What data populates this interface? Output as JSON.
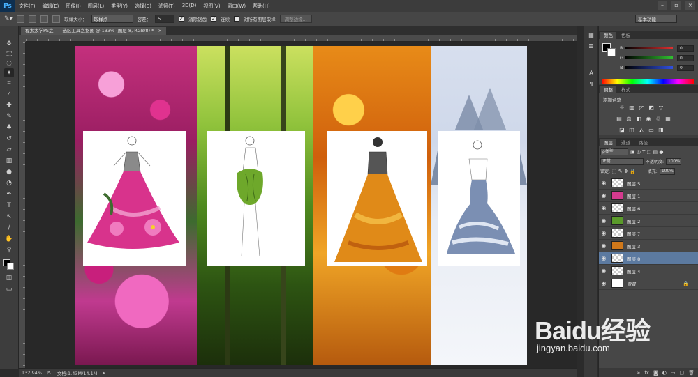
{
  "app": {
    "logo": "Ps"
  },
  "menu": [
    "文件(F)",
    "编辑(E)",
    "图像(I)",
    "图层(L)",
    "类型(Y)",
    "选择(S)",
    "滤镜(T)",
    "3D(D)",
    "视图(V)",
    "窗口(W)",
    "帮助(H)"
  ],
  "options": {
    "sample_size_label": "取样大小：",
    "sample_size_value": "取样点",
    "tolerance_label": "容差：",
    "tolerance_value": "5",
    "antialias_label": "消除锯齿",
    "contiguous_label": "连续",
    "sample_all_label": "对所有图层取样",
    "refine_edge_label": "调整边缘...",
    "workspace": "基本功能"
  },
  "document": {
    "tab_title": "程太太学PS之——选区工具之抠图 @ 133% (图层 8, RGB/8) *"
  },
  "status": {
    "zoom": "132.94%",
    "doc_info": "文档:1.43M/14.1M"
  },
  "color_panel": {
    "tabs": [
      "颜色",
      "色板"
    ],
    "sliders": [
      {
        "label": "R",
        "value": "0",
        "color": "#e03030"
      },
      {
        "label": "G",
        "value": "0",
        "color": "#30c030"
      },
      {
        "label": "B",
        "value": "0",
        "color": "#3050e0"
      }
    ]
  },
  "adjust_panel": {
    "tabs": [
      "调整",
      "样式"
    ],
    "add_label": "添加调整"
  },
  "layers_panel": {
    "tabs": [
      "图层",
      "通道",
      "路径"
    ],
    "filter_label": "ρ类型",
    "blend_mode": "正常",
    "opacity_label": "不透明度:",
    "opacity_value": "100%",
    "lock_label": "锁定:",
    "fill_label": "填充:",
    "fill_value": "100%",
    "layers": [
      {
        "name": "图层 5",
        "thumb": "#e8e8e8",
        "selected": false
      },
      {
        "name": "图层 1",
        "thumb": "#d43a8e",
        "selected": false
      },
      {
        "name": "图层 6",
        "thumb": "#e8e8e8",
        "selected": false
      },
      {
        "name": "图层 2",
        "thumb": "#5a9a2a",
        "selected": false
      },
      {
        "name": "图层 7",
        "thumb": "#e8e8e8",
        "selected": false
      },
      {
        "name": "图层 3",
        "thumb": "#d0781a",
        "selected": false
      },
      {
        "name": "图层 8",
        "thumb": "#e8e8e8",
        "selected": true
      },
      {
        "name": "图层 4",
        "thumb": "#e8e8e8",
        "selected": false
      },
      {
        "name": "背景",
        "thumb": "#ffffff",
        "selected": false
      }
    ]
  },
  "watermark": {
    "brand": "Baidu经验",
    "url": "jingyan.baidu.com"
  }
}
